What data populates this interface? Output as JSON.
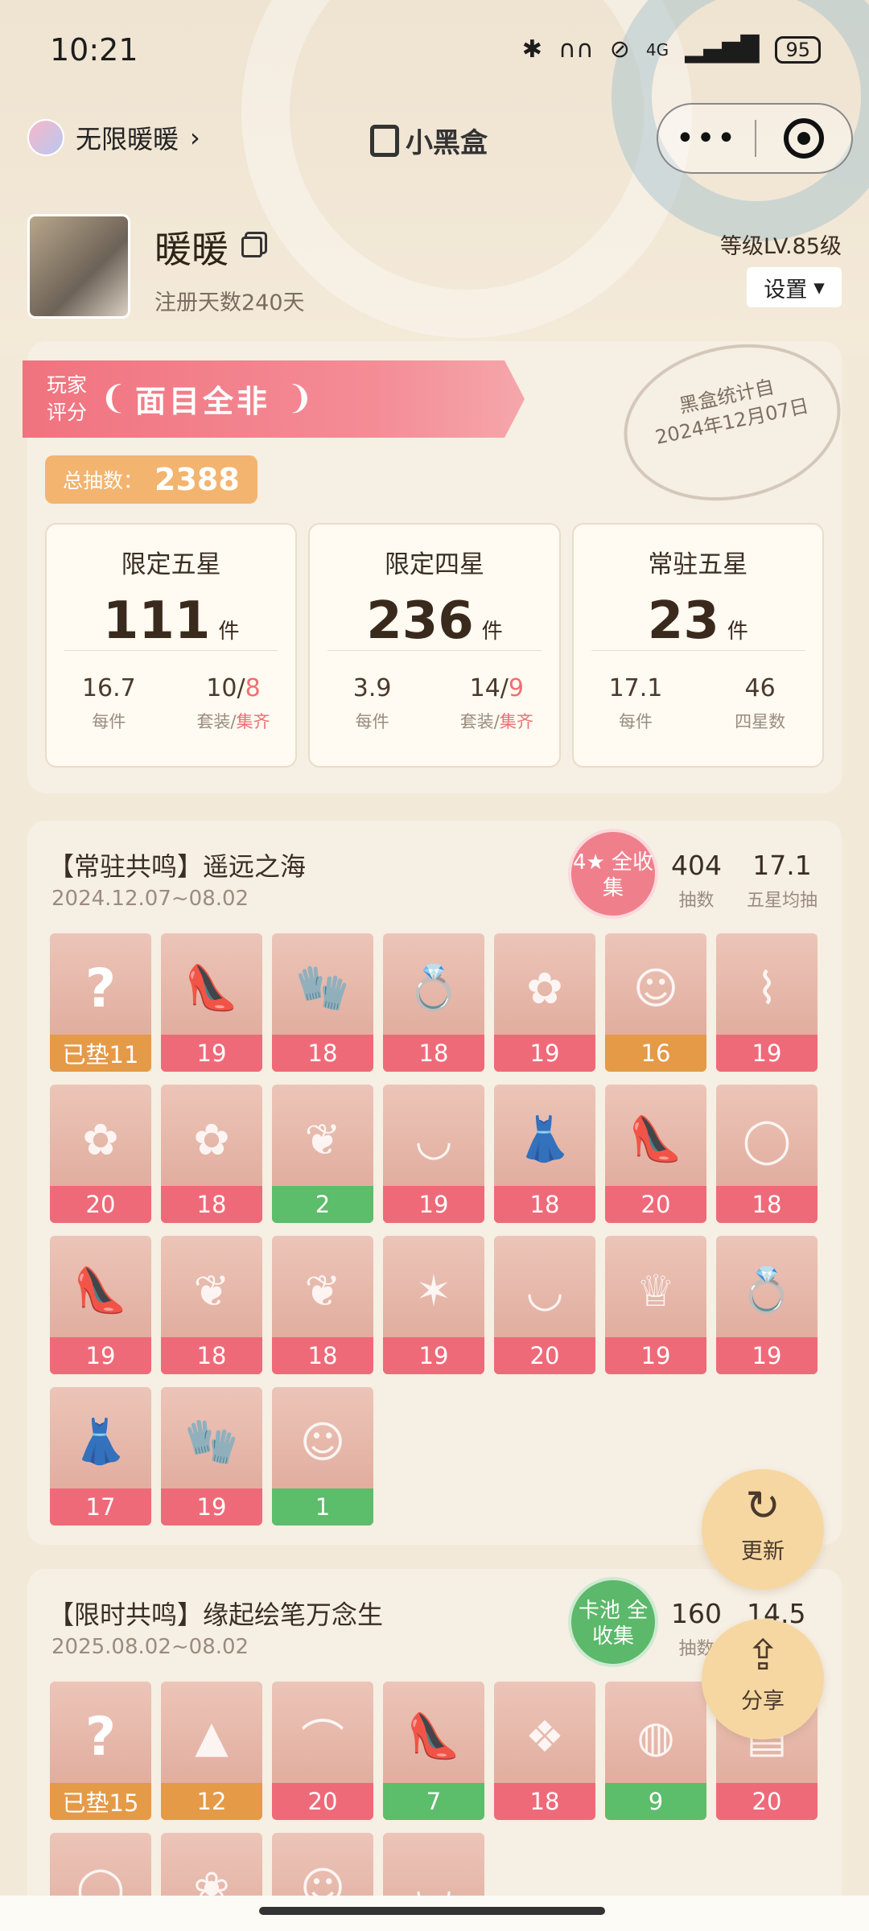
{
  "status_bar": {
    "time": "10:21",
    "network": "4G",
    "battery": "95"
  },
  "app_bar": {
    "back_label": "无限暖暖",
    "title": "小黑盒",
    "more": "•••"
  },
  "profile": {
    "nickname": "暖暖",
    "register_days": "注册天数240天",
    "level": "等级LV.85级",
    "settings_label": "设置"
  },
  "summary": {
    "rating_label": "玩家评分",
    "rating_value": "面目全非",
    "stamp_line1": "黑盒统计自",
    "stamp_line2": "2024年12月07日",
    "total_label": "总抽数：",
    "total_value": "2388",
    "cards": [
      {
        "title": "限定五星",
        "count": "111",
        "unit": "件",
        "left_value": "16.7",
        "left_label": "每件",
        "right_main": "10/",
        "right_red": "8",
        "right_label_a": "套装/",
        "right_label_b": "集齐"
      },
      {
        "title": "限定四星",
        "count": "236",
        "unit": "件",
        "left_value": "3.9",
        "left_label": "每件",
        "right_main": "14/",
        "right_red": "9",
        "right_label_a": "套装/",
        "right_label_b": "集齐"
      },
      {
        "title": "常驻五星",
        "count": "23",
        "unit": "件",
        "left_value": "17.1",
        "left_label": "每件",
        "right_main": "46",
        "right_red": "",
        "right_label_a": "四星数",
        "right_label_b": ""
      }
    ]
  },
  "pools": [
    {
      "title": "【常驻共鸣】遥远之海",
      "date": "2024.12.07~08.02",
      "badge": "4★ 全收集",
      "badge_color": "#f07f8c",
      "draws": "404",
      "draws_label": "抽数",
      "avg": "17.1",
      "avg_label": "五星均抽",
      "items": [
        {
          "label": "已垫11",
          "color": "orange",
          "icon": "question-mark"
        },
        {
          "label": "19",
          "color": "red",
          "icon": "shoes"
        },
        {
          "label": "18",
          "color": "red",
          "icon": "gloves"
        },
        {
          "label": "18",
          "color": "red",
          "icon": "ring"
        },
        {
          "label": "19",
          "color": "red",
          "icon": "hairpin"
        },
        {
          "label": "16",
          "color": "orange",
          "icon": "hairstyle"
        },
        {
          "label": "19",
          "color": "red",
          "icon": "stockings"
        },
        {
          "label": "20",
          "color": "red",
          "icon": "hairpin"
        },
        {
          "label": "18",
          "color": "red",
          "icon": "hairpin"
        },
        {
          "label": "2",
          "color": "green",
          "icon": "earrings"
        },
        {
          "label": "19",
          "color": "red",
          "icon": "necklace"
        },
        {
          "label": "18",
          "color": "red",
          "icon": "dress"
        },
        {
          "label": "20",
          "color": "red",
          "icon": "shoes"
        },
        {
          "label": "18",
          "color": "red",
          "icon": "bracelet"
        },
        {
          "label": "19",
          "color": "red",
          "icon": "shoes"
        },
        {
          "label": "18",
          "color": "red",
          "icon": "earrings"
        },
        {
          "label": "18",
          "color": "red",
          "icon": "earrings"
        },
        {
          "label": "19",
          "color": "red",
          "icon": "hair-accessory"
        },
        {
          "label": "20",
          "color": "red",
          "icon": "necklace"
        },
        {
          "label": "19",
          "color": "red",
          "icon": "crown"
        },
        {
          "label": "19",
          "color": "red",
          "icon": "ring"
        },
        {
          "label": "17",
          "color": "red",
          "icon": "dress"
        },
        {
          "label": "19",
          "color": "red",
          "icon": "gloves"
        },
        {
          "label": "1",
          "color": "green",
          "icon": "hairstyle"
        }
      ]
    },
    {
      "title": "【限时共鸣】缘起绘笔万念生",
      "date": "2025.08.02~08.02",
      "badge": "卡池 全收集",
      "badge_color": "#5cb86a",
      "draws": "160",
      "draws_label": "抽数",
      "avg": "14.5",
      "avg_label": "",
      "items": [
        {
          "label": "已垫15",
          "color": "orange",
          "icon": "question-mark"
        },
        {
          "label": "12",
          "color": "orange",
          "icon": "ears"
        },
        {
          "label": "20",
          "color": "red",
          "icon": "top"
        },
        {
          "label": "7",
          "color": "green",
          "icon": "shoes"
        },
        {
          "label": "18",
          "color": "red",
          "icon": "outfit"
        },
        {
          "label": "9",
          "color": "green",
          "icon": "tail"
        },
        {
          "label": "20",
          "color": "red",
          "icon": "scroll"
        },
        {
          "label": "",
          "color": "",
          "icon": "bracelet"
        },
        {
          "label": "",
          "color": "",
          "icon": "headpiece"
        },
        {
          "label": "",
          "color": "",
          "icon": "hairstyle"
        },
        {
          "label": "",
          "color": "",
          "icon": "necklace"
        }
      ]
    }
  ],
  "floating": {
    "refresh_label": "更新",
    "share_label": "分享"
  }
}
